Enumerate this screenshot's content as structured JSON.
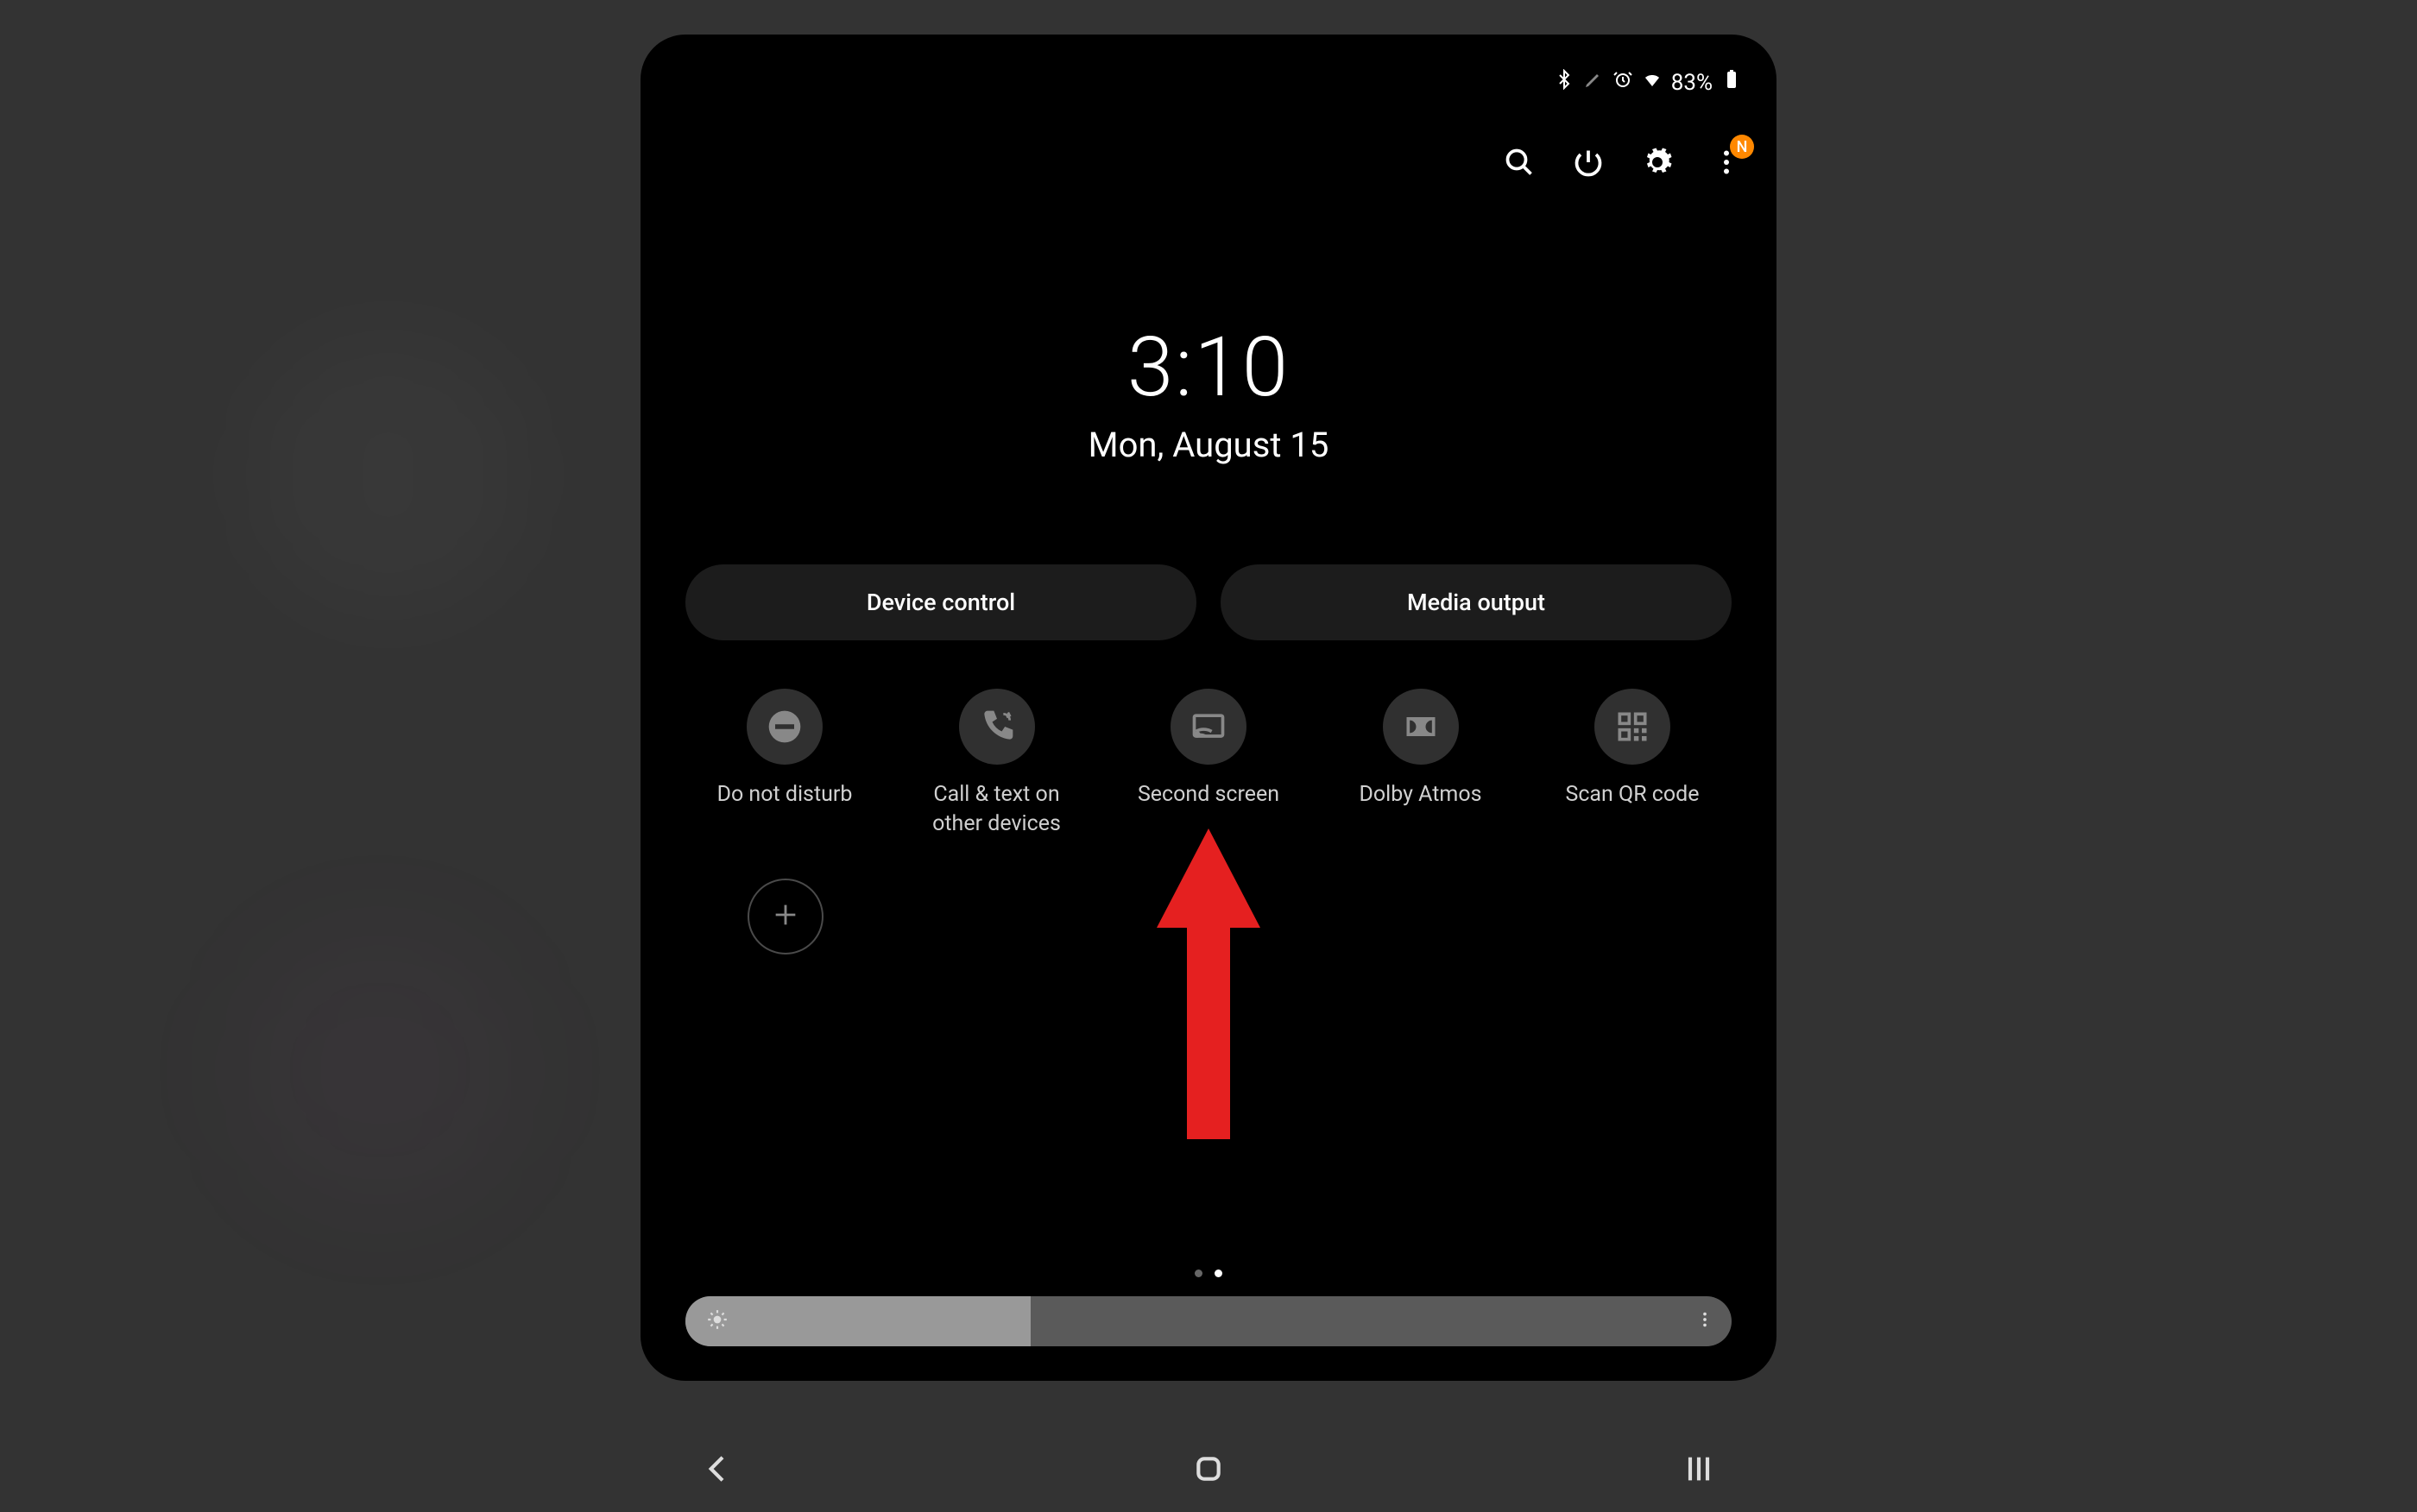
{
  "status": {
    "battery_text": "83%"
  },
  "action_bar": {
    "badge": "N"
  },
  "clock": {
    "time": "3:10",
    "date": "Mon, August 15"
  },
  "pills": {
    "device_control": "Device control",
    "media_output": "Media output"
  },
  "tiles": [
    {
      "label": "Do not disturb"
    },
    {
      "label": "Call & text on other devices"
    },
    {
      "label": "Second screen"
    },
    {
      "label": "Dolby Atmos"
    },
    {
      "label": "Scan QR code"
    }
  ],
  "brightness": {
    "percent": 33
  }
}
